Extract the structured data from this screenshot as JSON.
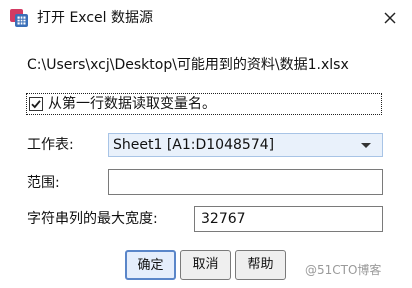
{
  "window": {
    "title": "打开 Excel 数据源",
    "app_icon": "spss-data-icon",
    "close_icon": "close-icon"
  },
  "file_path": "C:\\Users\\xcj\\Desktop\\可能用到的资料\\数据1.xlsx",
  "read_var_names": {
    "label": "从第一行数据读取变量名。",
    "checked": true
  },
  "worksheet": {
    "label": "工作表:",
    "selected": "Sheet1 [A1:D1048574]"
  },
  "range": {
    "label": "范围:",
    "value": ""
  },
  "max_width": {
    "label": "字符串列的最大宽度:",
    "value": "32767"
  },
  "buttons": {
    "ok": "确定",
    "cancel": "取消",
    "help": "帮助"
  },
  "watermark": "@51CTO博客",
  "colors": {
    "select_bg": "#e9f1fb",
    "default_button_border": "#5a86c9"
  }
}
